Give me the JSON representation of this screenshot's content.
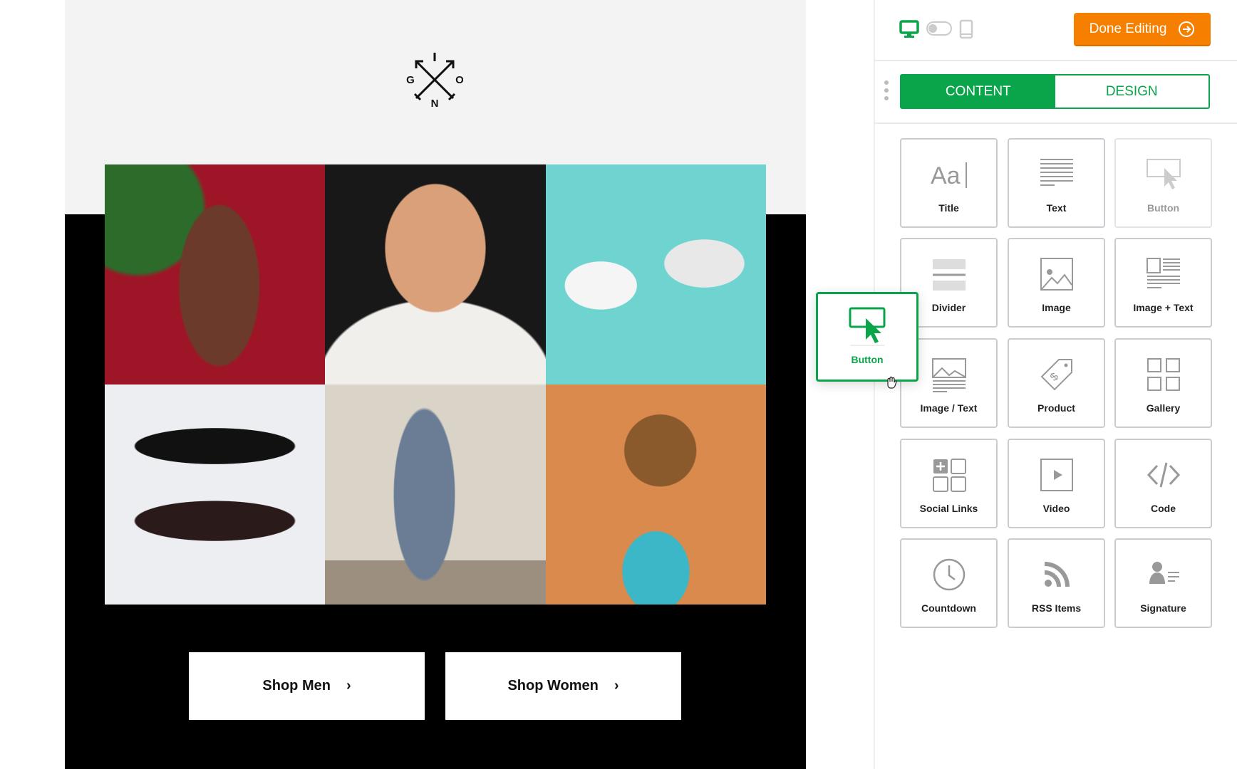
{
  "email": {
    "logo_letters": [
      "G",
      "O",
      "N",
      "I"
    ],
    "photos": [
      {
        "subject": "woman-red-background",
        "color": "#9e1527"
      },
      {
        "subject": "bearded-man",
        "color": "#1a1a1a"
      },
      {
        "subject": "white-sneakers",
        "color": "#6fd3cf"
      },
      {
        "subject": "sunglasses",
        "color": "#eceef2"
      },
      {
        "subject": "couple-wall",
        "color": "#d6d0c5"
      },
      {
        "subject": "woman-orange-background",
        "color": "#d98a4c"
      }
    ],
    "buttons": [
      {
        "label": "Shop Men"
      },
      {
        "label": "Shop Women"
      }
    ]
  },
  "toolbar": {
    "view_modes": [
      "desktop",
      "mobile"
    ],
    "active_view": "desktop",
    "done_label": "Done Editing"
  },
  "tabs": [
    {
      "label": "CONTENT",
      "active": true
    },
    {
      "label": "DESIGN",
      "active": false
    }
  ],
  "blocks": [
    {
      "label": "Title",
      "icon": "title-icon"
    },
    {
      "label": "Text",
      "icon": "text-icon"
    },
    {
      "label": "Button",
      "icon": "button-icon",
      "dragging": true
    },
    {
      "label": "Divider",
      "icon": "divider-icon"
    },
    {
      "label": "Image",
      "icon": "image-icon"
    },
    {
      "label": "Image + Text",
      "icon": "image-text-icon"
    },
    {
      "label": "Image / Text",
      "icon": "image-over-text-icon"
    },
    {
      "label": "Product",
      "icon": "price-tag-icon"
    },
    {
      "label": "Gallery",
      "icon": "gallery-icon"
    },
    {
      "label": "Social Links",
      "icon": "social-icon"
    },
    {
      "label": "Video",
      "icon": "video-icon"
    },
    {
      "label": "Code",
      "icon": "code-icon"
    },
    {
      "label": "Countdown",
      "icon": "clock-icon"
    },
    {
      "label": "RSS Items",
      "icon": "rss-icon"
    },
    {
      "label": "Signature",
      "icon": "signature-icon"
    }
  ],
  "drag_block": {
    "label": "Button"
  },
  "colors": {
    "accent": "#0aa44a",
    "done": "#f77f00"
  }
}
